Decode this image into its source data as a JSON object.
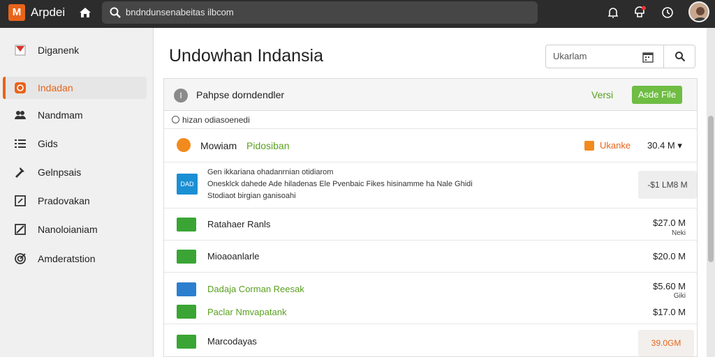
{
  "app": {
    "logo_letter": "M",
    "title": "Arpdei"
  },
  "url": {
    "text": "bndndunsenabeitas ilbcom"
  },
  "sidebar": {
    "items": [
      {
        "label": "Diganenk",
        "icon": "bookmark-icon"
      },
      {
        "label": "Indadan",
        "icon": "play-icon",
        "active": true
      },
      {
        "label": "Nandmam",
        "icon": "users-icon"
      },
      {
        "label": "Gids",
        "icon": "list-icon"
      },
      {
        "label": "Gelnpsais",
        "icon": "hammer-icon"
      },
      {
        "label": "Pradovakan",
        "icon": "edit-icon"
      },
      {
        "label": "Nanoloianiam",
        "icon": "chart-icon"
      },
      {
        "label": "Amderatstion",
        "icon": "target-icon"
      }
    ]
  },
  "main": {
    "title": "Undowhan Indansia",
    "search": {
      "placeholder": "Ukarlam"
    },
    "card": {
      "header_title": "Pahpse dorndendler",
      "info_letter": "I",
      "version_label": "Versi",
      "add_button": "Asde File",
      "filter_label": "hizan odiasoenedi",
      "group": {
        "name": "Mowiam",
        "name_highlight": "Pidosiban",
        "tag": "Ukanke",
        "size": "30.4 M"
      },
      "description": {
        "icon_text": "DAD",
        "lines": [
          "Gen ikkariana ohadanrnian otidiarom",
          "Onesklck dahede Ade hiladenas Ele Pvenbaic Fikes hisinamme ha Nale Ghidi",
          "Stodiaot birgian ganisoahi"
        ],
        "badge": "-$1 LM8 M"
      },
      "rows": [
        {
          "name": "Ratahaer Ranls",
          "value": "$27.0 M",
          "sub": "Neki",
          "green": false,
          "icon_color": "#3aa534"
        },
        {
          "name": "Mioaoanlarle",
          "value": "$20.0 M",
          "sub": "",
          "green": false,
          "icon_color": "#3aa534"
        },
        {
          "name": "Dadaja Corman Reesak",
          "value": "$5.60 M",
          "sub": "Giki",
          "green": true,
          "icon_color": "#2c7fcf"
        },
        {
          "name": "Paclar Nmvapatank",
          "value": "$17.0 M",
          "sub": "",
          "green": true,
          "icon_color": "#3aa534"
        },
        {
          "name": "Marcodayas",
          "value": "",
          "sub": "",
          "green": false,
          "icon_color": "#3aa534",
          "badge": "39.0GM"
        }
      ]
    }
  }
}
